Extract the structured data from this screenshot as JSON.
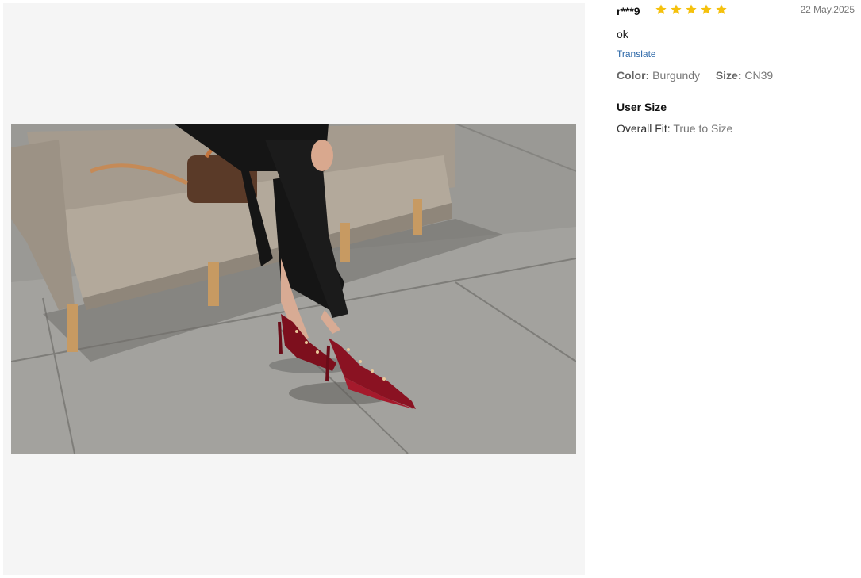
{
  "review": {
    "reviewer": "r***9",
    "rating": 5,
    "rating_max": 5,
    "date": "22 May,2025",
    "text": "ok",
    "translate_label": "Translate",
    "color_key": "Color:",
    "color_value": "Burgundy",
    "size_key": "Size:",
    "size_value": "CN39",
    "user_size_title": "User Size",
    "fit_key": "Overall Fit:",
    "fit_value": "True to Size"
  },
  "colors": {
    "star": "#f5c10d",
    "link": "#2d68a8",
    "viewer_bg": "#f5f5f5"
  },
  "icons": {
    "rating": "star-icon"
  },
  "photo": {
    "alt": "Customer photo of burgundy studded pointed-toe heels worn while seated on a beige sofa"
  }
}
